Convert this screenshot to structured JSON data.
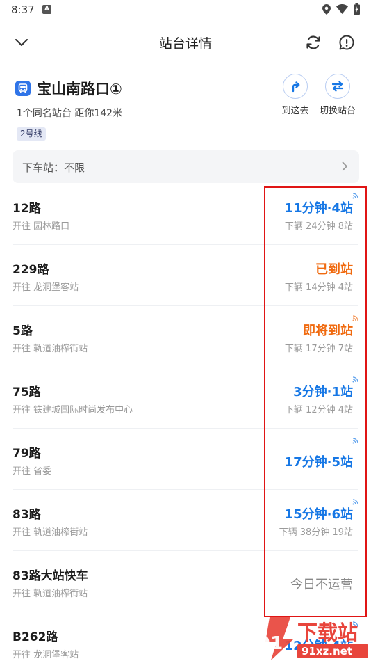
{
  "status_bar": {
    "time": "8:37",
    "notification_letter": "A"
  },
  "header": {
    "title": "站台详情"
  },
  "stop": {
    "name": "宝山南路口①",
    "subtitle": "1个同名站台  距你142米",
    "line_badge": "2号线",
    "actions": [
      {
        "label": "到这去",
        "icon": "turn-right-arrow-icon"
      },
      {
        "label": "切换站台",
        "icon": "swap-arrows-icon"
      }
    ]
  },
  "alight": {
    "label": "下车站：不限"
  },
  "routes": [
    {
      "name": "12路",
      "dest": "开往 园林路口",
      "eta": "11分钟·4站",
      "next": "下辆  24分钟 8站",
      "status": "blue",
      "realtime": true
    },
    {
      "name": "229路",
      "dest": "开往 龙洞堡客站",
      "eta": "已到站",
      "next": "下辆  14分钟 4站",
      "status": "orange",
      "realtime": false
    },
    {
      "name": "5路",
      "dest": "开往 轨道油榨街站",
      "eta": "即将到站",
      "next": "下辆  17分钟 7站",
      "status": "orange",
      "realtime": true
    },
    {
      "name": "75路",
      "dest": "开往 铁建城国际时尚发布中心",
      "eta": "3分钟·1站",
      "next": "下辆  12分钟 4站",
      "status": "blue",
      "realtime": true
    },
    {
      "name": "79路",
      "dest": "开往 省委",
      "eta": "17分钟·5站",
      "next": "",
      "status": "blue",
      "realtime": true
    },
    {
      "name": "83路",
      "dest": "开往 轨道油榨街站",
      "eta": "15分钟·6站",
      "next": "下辆  38分钟 19站",
      "status": "blue",
      "realtime": true
    },
    {
      "name": "83路大站快车",
      "dest": "开往 轨道油榨街站",
      "eta": "今日不运营",
      "next": "",
      "status": "gray",
      "realtime": false
    },
    {
      "name": "B262路",
      "dest": "开往 龙洞堡客站",
      "eta": "12分钟·4站",
      "next": "",
      "status": "blue",
      "realtime": true
    }
  ],
  "colors": {
    "blue": "#1677e5",
    "orange": "#f06a0f",
    "gray": "#888888",
    "highlight": "#e01515"
  },
  "watermark": {
    "text": "下载站",
    "url_text": "91xz.net",
    "logo_text": "91"
  }
}
